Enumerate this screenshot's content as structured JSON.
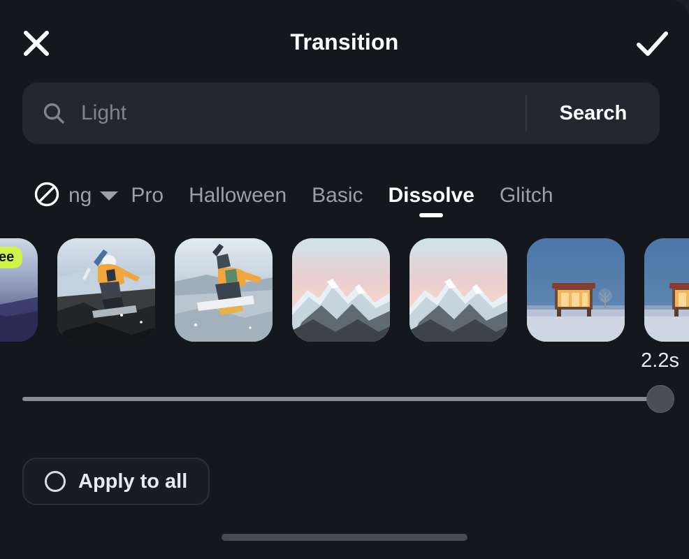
{
  "header": {
    "title": "Transition",
    "close_icon": "close-x-icon",
    "confirm_icon": "checkmark-icon"
  },
  "search": {
    "icon": "search-icon",
    "value": "",
    "placeholder": "Light",
    "submit_label": "Search"
  },
  "tabs": {
    "none_icon": "prohibition-none-icon",
    "group_label": "ng",
    "caret_icon": "chevron-down-icon",
    "items": [
      {
        "label": "Pro",
        "active": false
      },
      {
        "label": "Halloween",
        "active": false
      },
      {
        "label": "Basic",
        "active": false
      },
      {
        "label": "Dissolve",
        "active": true
      },
      {
        "label": "Glitch",
        "active": false
      }
    ]
  },
  "thumbnails": [
    {
      "name": "thumb-snowboarder-purple",
      "badge": "Free",
      "scene": "snowboard_purple"
    },
    {
      "name": "thumb-snowboarder-a",
      "badge": "",
      "scene": "snowboard_a"
    },
    {
      "name": "thumb-snowboarder-b",
      "badge": "",
      "scene": "snowboard_b"
    },
    {
      "name": "thumb-mountains-a",
      "badge": "",
      "scene": "mountains"
    },
    {
      "name": "thumb-mountains-b",
      "badge": "",
      "scene": "mountains"
    },
    {
      "name": "thumb-cabin-a",
      "badge": "",
      "scene": "cabin"
    },
    {
      "name": "thumb-cabin-b",
      "badge": "",
      "scene": "cabin"
    }
  ],
  "duration": {
    "label": "2.2s",
    "slider_percent": 100
  },
  "apply_all": {
    "label": "Apply to all",
    "checked": false,
    "radio_icon": "radio-unchecked-icon"
  },
  "colors": {
    "panel_bg": "#14171c",
    "search_bg": "#24272e",
    "accent_free_badge": "#cdf548",
    "text_primary": "#ffffff",
    "text_secondary": "#9aa0a9"
  }
}
